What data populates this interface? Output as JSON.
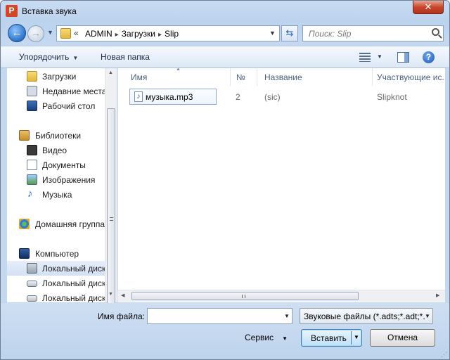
{
  "window": {
    "title": "Вставка звука",
    "app_icon_letter": "P",
    "close_glyph": "✕"
  },
  "navigation": {
    "back_glyph": "←",
    "forward_glyph": "→",
    "history_drop_glyph": "▼",
    "root_glyph": "«",
    "breadcrumbs": [
      "ADMIN",
      "Загрузки",
      "Slip"
    ],
    "separator_glyph": "▸",
    "address_drop_glyph": "▼",
    "refresh_glyph": "⇆",
    "search_placeholder": "Поиск: Slip"
  },
  "toolbar": {
    "organize_label": "Упорядочить",
    "new_folder_label": "Новая папка",
    "drop_glyph": "▼",
    "help_glyph": "?"
  },
  "sidebar": {
    "items": [
      {
        "label": "Загрузки",
        "icon": "downloads-folder-icon"
      },
      {
        "label": "Недавние места",
        "icon": "recent-places-icon"
      },
      {
        "label": "Рабочий стол",
        "icon": "desktop-icon"
      },
      {
        "label": "Библиотеки",
        "icon": "libraries-icon"
      },
      {
        "label": "Видео",
        "icon": "video-icon"
      },
      {
        "label": "Документы",
        "icon": "documents-icon"
      },
      {
        "label": "Изображения",
        "icon": "images-icon"
      },
      {
        "label": "Музыка",
        "icon": "music-icon",
        "glyph": "♪"
      },
      {
        "label": "Домашняя группа",
        "icon": "homegroup-icon"
      },
      {
        "label": "Компьютер",
        "icon": "computer-icon"
      },
      {
        "label": "Локальный диск",
        "icon": "local-disk-windows-icon"
      },
      {
        "label": "Локальный диск",
        "icon": "local-disk-icon"
      },
      {
        "label": "Локальный диск",
        "icon": "local-disk-icon"
      }
    ],
    "selected_index": 10
  },
  "file_list": {
    "columns": [
      "Имя",
      "№",
      "Название",
      "Участвующие ис..."
    ],
    "sort_glyph": "▲",
    "rows": [
      {
        "name": "музыка.mp3",
        "number": "2",
        "title": "(sic)",
        "artist": "Slipknot",
        "icon_glyph": "♪"
      }
    ]
  },
  "scroll": {
    "up_glyph": "▲",
    "down_glyph": "▼",
    "left_glyph": "◀",
    "right_glyph": "▶"
  },
  "footer": {
    "filename_label": "Имя файла:",
    "filename_value": "",
    "filter_value": "Звуковые файлы (*.adts;*.adt;*.",
    "service_label": "Сервис",
    "insert_label": "Вставить",
    "cancel_label": "Отмена",
    "drop_glyph": "▼",
    "grip_glyph": "⋰"
  },
  "colors": {
    "accent": "#3c7fb1",
    "close": "#c7472d",
    "frame": "#c4d8f0"
  }
}
